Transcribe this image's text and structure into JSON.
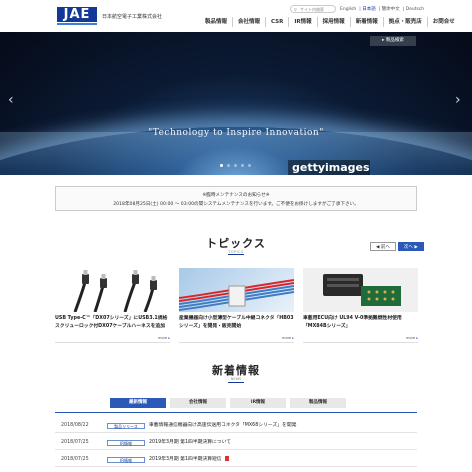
{
  "header": {
    "logo_text": "JAE",
    "company_name": "日本航空電子工業株式会社",
    "search_placeholder": "サイト内検索",
    "languages": [
      "English",
      "日本語",
      "簡体中文",
      "Deutsch"
    ],
    "active_language": "日本語",
    "nav": [
      "製品情報",
      "会社情報",
      "CSR",
      "IR情報",
      "採用情報",
      "新着情報",
      "拠点・販売店",
      "お問合せ"
    ]
  },
  "hero": {
    "product_search_label": "製品検索",
    "tagline": "\"Technology to Inspire Innovation\"",
    "watermark": "gettyimages",
    "slide_count": 5,
    "active_slide": 1
  },
  "notice": {
    "title": "※臨時メンテナンスのお知らせ※",
    "body": "2018年08月25日(土) 00:00 ～ 03:00の間システムメンテナンスを行います。ご不便をお掛けしますがご了承下さい。"
  },
  "topics": {
    "title": "トピックス",
    "subtitle": "TOPICS",
    "prev_label": "◀ 前へ",
    "next_label": "次へ ▶",
    "more_label": "more",
    "cards": [
      {
        "caption": "USB Type-C™「DX07シリーズ」にUSB3.1規格スクリューロック付DX07ケーブルハーネスを追加"
      },
      {
        "caption": "産業機器向け小型薄型ケーブル中継コネクタ「HB03シリーズ」を開発・販売開始"
      },
      {
        "caption": "車載用ECU向け UL94 V-0準拠難燃性材使用「MX84Bシリーズ」"
      }
    ]
  },
  "news": {
    "title": "新着情報",
    "subtitle": "NEWS",
    "tabs": [
      "最新情報",
      "会社情報",
      "IR情報",
      "製品情報"
    ],
    "active_tab": "最新情報",
    "rows": [
      {
        "date": "2018/08/22",
        "category": "製品リリース",
        "title": "車載情報通信機器向け高速伝送用コネクタ「MX68シリーズ」を開発",
        "pdf": false
      },
      {
        "date": "2018/07/25",
        "category": "IR情報",
        "title": "2019年3月期 第1四半期決算について",
        "pdf": false
      },
      {
        "date": "2018/07/25",
        "category": "IR情報",
        "title": "2019年3月期 第1四半期決算短信",
        "pdf": true
      }
    ]
  },
  "colors": {
    "brand_blue": "#12389a",
    "accent_blue": "#2b59b8"
  }
}
